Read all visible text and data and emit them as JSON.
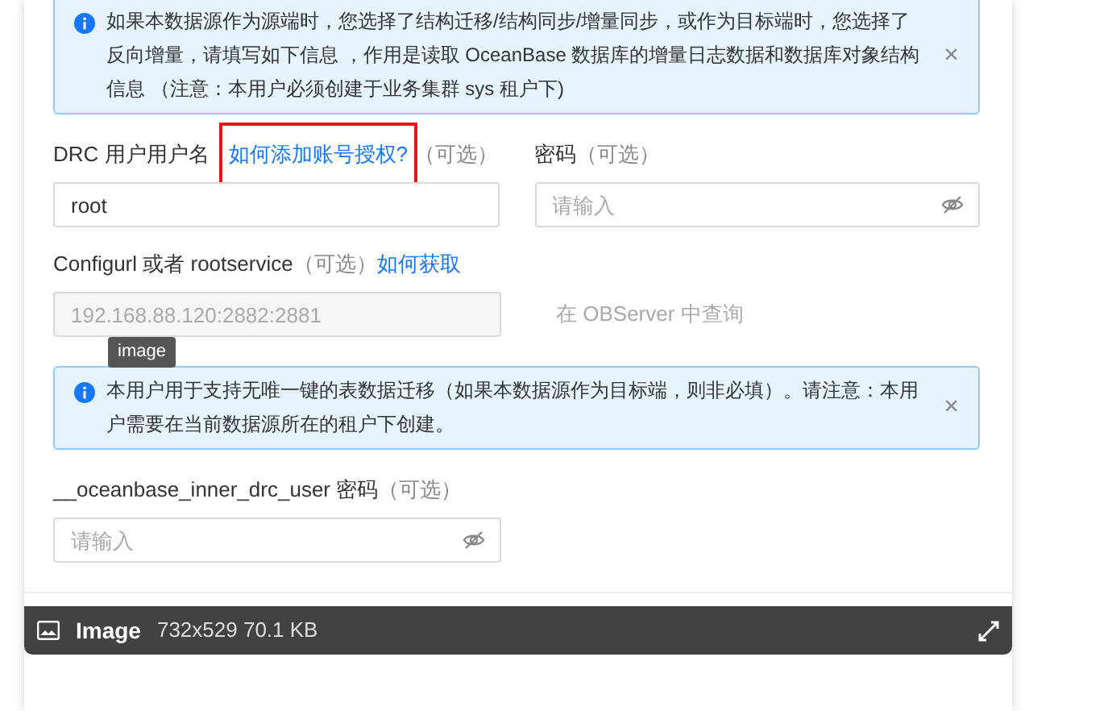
{
  "alerts": [
    {
      "text": "如果本数据源作为源端时，您选择了结构迁移/结构同步/增量同步，或作为目标端时，您选择了反向增量，请填写如下信息 ，作用是读取 OceanBase 数据库的增量日志数据和数据库对象结构信息 （注意：本用户必须创建于业务集群 sys 租户下)",
      "close": "×"
    }
  ],
  "row_fields": [
    {
      "label": "DRC 用户用户名",
      "link": "如何添加账号授权?",
      "optional": "（可选）",
      "value": "root",
      "highlighted": true,
      "kind": "text"
    },
    {
      "label": "密码",
      "optional": "（可选）",
      "placeholder": "请输入",
      "kind": "password"
    }
  ],
  "config": {
    "label": "Configurl 或者 rootservice",
    "optional": "（可选）",
    "link": "如何获取",
    "value": "192.168.88.120:2882:2881",
    "disabled": true,
    "side_text": "在 OBServer 中查询",
    "tooltip": "image"
  },
  "alert2": {
    "text": "本用户用于支持无唯一键的表数据迁移（如果本数据源作为目标端，则非必填）。请注意：本用户需要在当前数据源所在的租户下创建。",
    "close": "×"
  },
  "inner_field": {
    "label": "__oceanbase_inner_drc_user 密码",
    "optional": "（可选）",
    "placeholder": "请输入",
    "kind": "password"
  },
  "viewer_bar": {
    "title": "Image",
    "info": "732x529 70.1 KB"
  }
}
